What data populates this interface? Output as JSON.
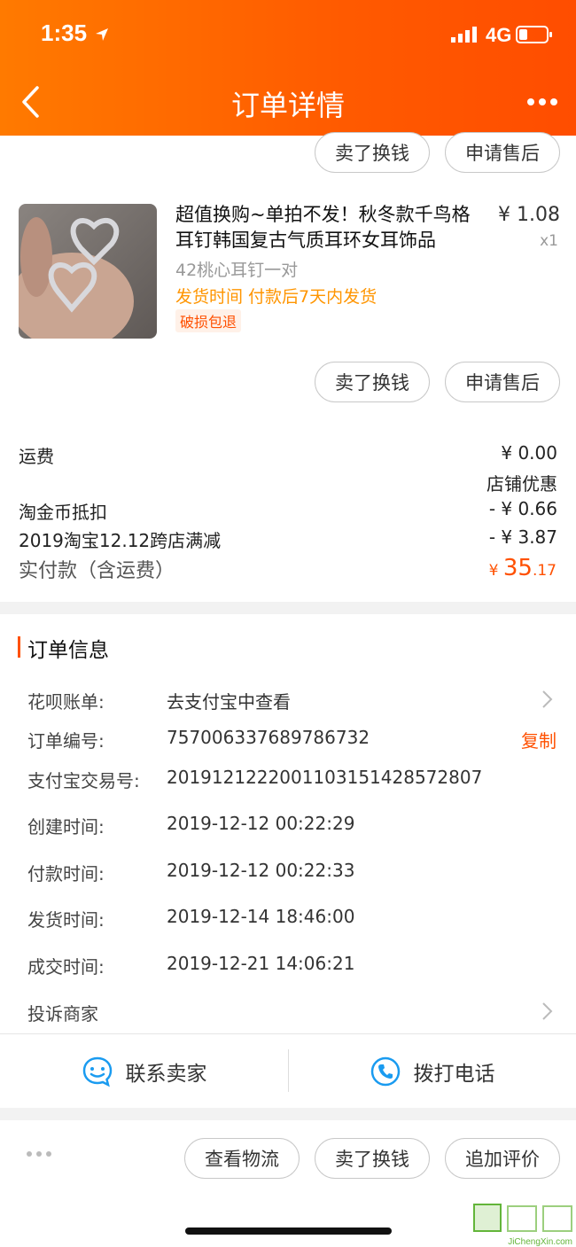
{
  "status_bar": {
    "time": "1:35",
    "network": "4G"
  },
  "header": {
    "title": "订单详情"
  },
  "top_actions": {
    "sell": "卖了换钱",
    "after_sale": "申请售后"
  },
  "product": {
    "title": "超值换购~单拍不发！秋冬款千鸟格耳钉韩国复古气质耳环女耳饰品",
    "price": "¥ 1.08",
    "qty": "x1",
    "sku": "42桃心耳钉一对",
    "ship_time": "发货时间  付款后7天内发货",
    "tag": "破损包退",
    "sell_label": "卖了换钱",
    "after_sale_label": "申请售后"
  },
  "fees": {
    "shipping_label": "运费",
    "shipping_value": "¥ 0.00",
    "store_discount_label": "店铺优惠",
    "coin_label": "淘金币抵扣",
    "coin_value": "- ¥ 0.66",
    "promo_label": "2019淘宝12.12跨店满减",
    "promo_value": "- ¥ 3.87",
    "paid_label": "实付款（含运费）",
    "paid_symbol": "¥ ",
    "paid_int": "35",
    "paid_dec": ".17"
  },
  "order_info": {
    "section_title": "订单信息",
    "copy_label": "复制",
    "rows": [
      {
        "label": "花呗账单:",
        "value": "去支付宝中查看"
      },
      {
        "label": "订单编号:",
        "value": "757006337689786732"
      },
      {
        "label": "支付宝交易号:",
        "value": "2019121222001103151428572807"
      },
      {
        "label": "创建时间:",
        "value": "2019-12-12 00:22:29"
      },
      {
        "label": "付款时间:",
        "value": "2019-12-12 00:22:33"
      },
      {
        "label": "发货时间:",
        "value": "2019-12-14 18:46:00"
      },
      {
        "label": "成交时间:",
        "value": "2019-12-21 14:06:21"
      },
      {
        "label": "投诉商家",
        "value": ""
      }
    ]
  },
  "contact": {
    "seller": "联系卖家",
    "phone": "拨打电话"
  },
  "bottom_actions": {
    "logistics": "查看物流",
    "sell": "卖了换钱",
    "review": "追加评价"
  },
  "watermark": {
    "text": "JiChengXin.com"
  },
  "colors": {
    "accent": "#ff5000",
    "header_start": "#ff7a00",
    "header_end": "#ff4d00",
    "ship": "#ff9500",
    "contact_icon": "#1a9bf0"
  }
}
